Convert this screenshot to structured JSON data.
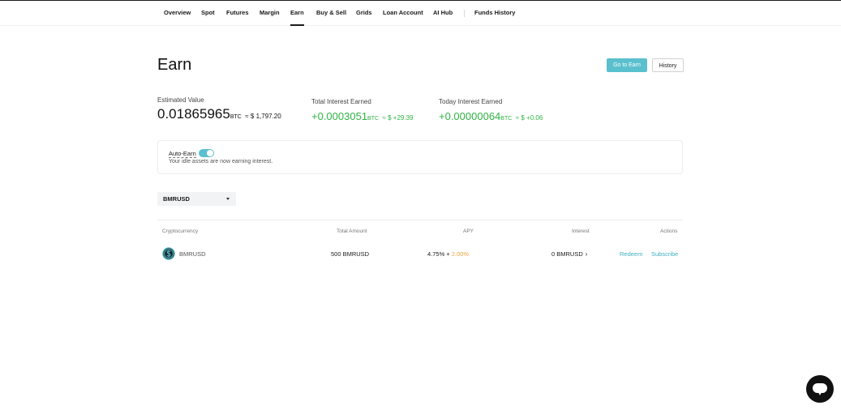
{
  "nav": {
    "items": [
      "Overview",
      "Spot",
      "Futures",
      "Margin",
      "Earn",
      "Buy & Sell",
      "Grids",
      "Loan Account",
      "AI Hub"
    ],
    "funds_history": "Funds History",
    "active": "Earn"
  },
  "header": {
    "title": "Earn",
    "go_to_earn": "Go to Earn",
    "history": "History"
  },
  "stats": {
    "estimated": {
      "label": "Estimated Value",
      "value": "0.01865965",
      "unit": "BTC",
      "fiat": "≈ $ 1,797.20"
    },
    "total_interest": {
      "label": "Total Interest Earned",
      "value": "+0.0003051",
      "unit": "BTC",
      "fiat": "≈ $ +29.39"
    },
    "today_interest": {
      "label": "Today Interest Earned",
      "value": "+0.00000064",
      "unit": "BTC",
      "fiat": "≈ $ +0.06"
    }
  },
  "auto_earn": {
    "label": "Auto-Earn",
    "enabled": true,
    "description": "Your idle assets are now earning interest."
  },
  "filter": {
    "selected": "BMRUSD"
  },
  "table": {
    "headers": {
      "crypto": "Cryptocurrency",
      "amount": "Total Amount",
      "apy": "APY",
      "interest": "Interest",
      "actions": "Actions"
    },
    "rows": [
      {
        "coin": "BMRUSD",
        "amount": "500 BMRUSD",
        "apy_base": "4.75% + ",
        "apy_bonus": "2.00%",
        "interest": "0 BMRUSD",
        "redeem": "Redeem",
        "subscribe": "Subscribe",
        "coin_icon": "dollar-coin-icon"
      }
    ]
  },
  "colors": {
    "accent": "#5bc0ce",
    "positive": "#2fb344",
    "bonus": "#f0a23a",
    "link": "#3fb0c0"
  }
}
